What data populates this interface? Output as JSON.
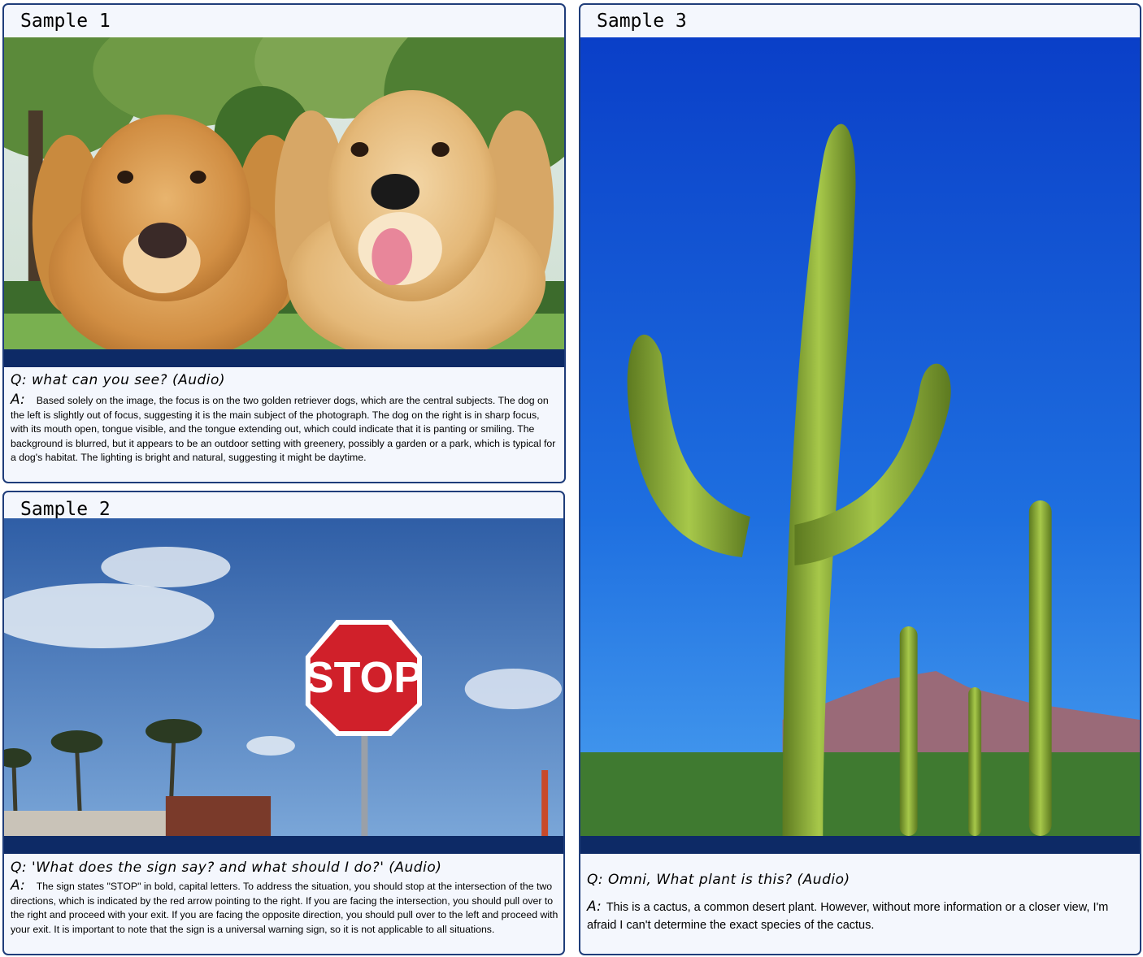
{
  "samples": [
    {
      "title": "Sample 1",
      "question": "Q: what can you see? (Audio)",
      "answer_label": "A:",
      "answer": "Based solely on the image, the focus is on the two golden retriever dogs, which are the central subjects. The dog on the left is slightly out of focus, suggesting it is the main subject of the photograph. The dog on the right is in sharp focus, with its mouth open, tongue visible, and the tongue extending out, which could indicate that it is panting or smiling. The background is blurred, but it appears to be an outdoor setting with greenery, possibly a garden or a park, which is typical for a dog's habitat. The lighting is bright and natural, suggesting it might be daytime."
    },
    {
      "title": "Sample 2",
      "question": "Q: 'What does the sign say? and what should I do?' (Audio)",
      "answer_label": "A:",
      "answer": "The sign states \"STOP\" in bold, capital letters. To address the situation, you should stop at the intersection of the two directions, which is indicated by the red arrow pointing to the right. If you are facing the intersection, you should pull over to the right and proceed with your exit. If you are facing the opposite direction, you should pull over to the left and proceed with your exit. It is important to note that the sign is a universal warning sign, so it is not applicable to all situations.",
      "sign_text": "STOP"
    },
    {
      "title": "Sample 3",
      "question": "Q: Omni, What plant is this? (Audio)",
      "answer_label": "A:",
      "answer": "This is a cactus, a common desert plant. However, without more information or a closer view, I'm afraid I can't determine the exact species of the cactus."
    }
  ],
  "colors": {
    "border": "#1f3d7a",
    "bar": "#0d2a66",
    "card_bg": "#f4f7fd"
  }
}
